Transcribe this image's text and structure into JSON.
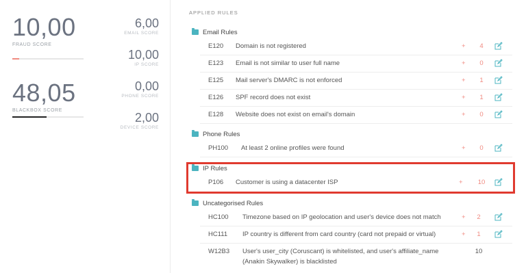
{
  "scores": {
    "fraud": {
      "value": "10,00",
      "label": "FRAUD SCORE",
      "bar_fraction": 0.1,
      "bar_color": "#f08a80"
    },
    "blackbox": {
      "value": "48,05",
      "label": "BLACKBOX SCORE",
      "bar_fraction": 0.48,
      "bar_color": "#222222"
    },
    "email": {
      "value": "6,00",
      "label": "EMAIL SCORE"
    },
    "ip": {
      "value": "10,00",
      "label": "IP SCORE"
    },
    "phone": {
      "value": "0,00",
      "label": "PHONE SCORE"
    },
    "device": {
      "value": "2,00",
      "label": "DEVICE SCORE"
    }
  },
  "rules_title": "APPLIED RULES",
  "categories": [
    {
      "name": "Email Rules",
      "rules": [
        {
          "code": "E120",
          "desc": "Domain is not registered",
          "plus": "+",
          "score": "4"
        },
        {
          "code": "E123",
          "desc": "Email is not similar to user full name",
          "plus": "+",
          "score": "0"
        },
        {
          "code": "E125",
          "desc": "Mail server's DMARC is not enforced",
          "plus": "+",
          "score": "1"
        },
        {
          "code": "E126",
          "desc": "SPF record does not exist",
          "plus": "+",
          "score": "1"
        },
        {
          "code": "E128",
          "desc": "Website does not exist on email's domain",
          "plus": "+",
          "score": "0"
        }
      ]
    },
    {
      "name": "Phone Rules",
      "rules": [
        {
          "code": "PH100",
          "desc": "At least 2 online profiles were found",
          "plus": "+",
          "score": "0"
        }
      ]
    },
    {
      "name": "IP Rules",
      "rules": [
        {
          "code": "P106",
          "desc": "Customer is using a datacenter ISP",
          "plus": "+",
          "score": "10"
        }
      ]
    },
    {
      "name": "Uncategorised Rules",
      "rules": [
        {
          "code": "HC100",
          "desc": "Timezone based on IP geolocation and user's device does not match",
          "plus": "+",
          "score": "2"
        },
        {
          "code": "HC111",
          "desc": "IP country is different from card country (card not prepaid or virtual)",
          "plus": "+",
          "score": "1"
        },
        {
          "code": "W12B3",
          "desc_line1": "User's user_city (Coruscant) is whitelisted, and user's affiliate_name",
          "desc_line2": "(Anakin Skywalker) is blacklisted",
          "score": "10"
        }
      ]
    }
  ],
  "colors": {
    "accent": "#4bb4c0",
    "score_red": "#f08a80",
    "highlight": "#e03a2f"
  },
  "icons": {
    "category": "folder-icon",
    "edit": "edit-icon"
  }
}
